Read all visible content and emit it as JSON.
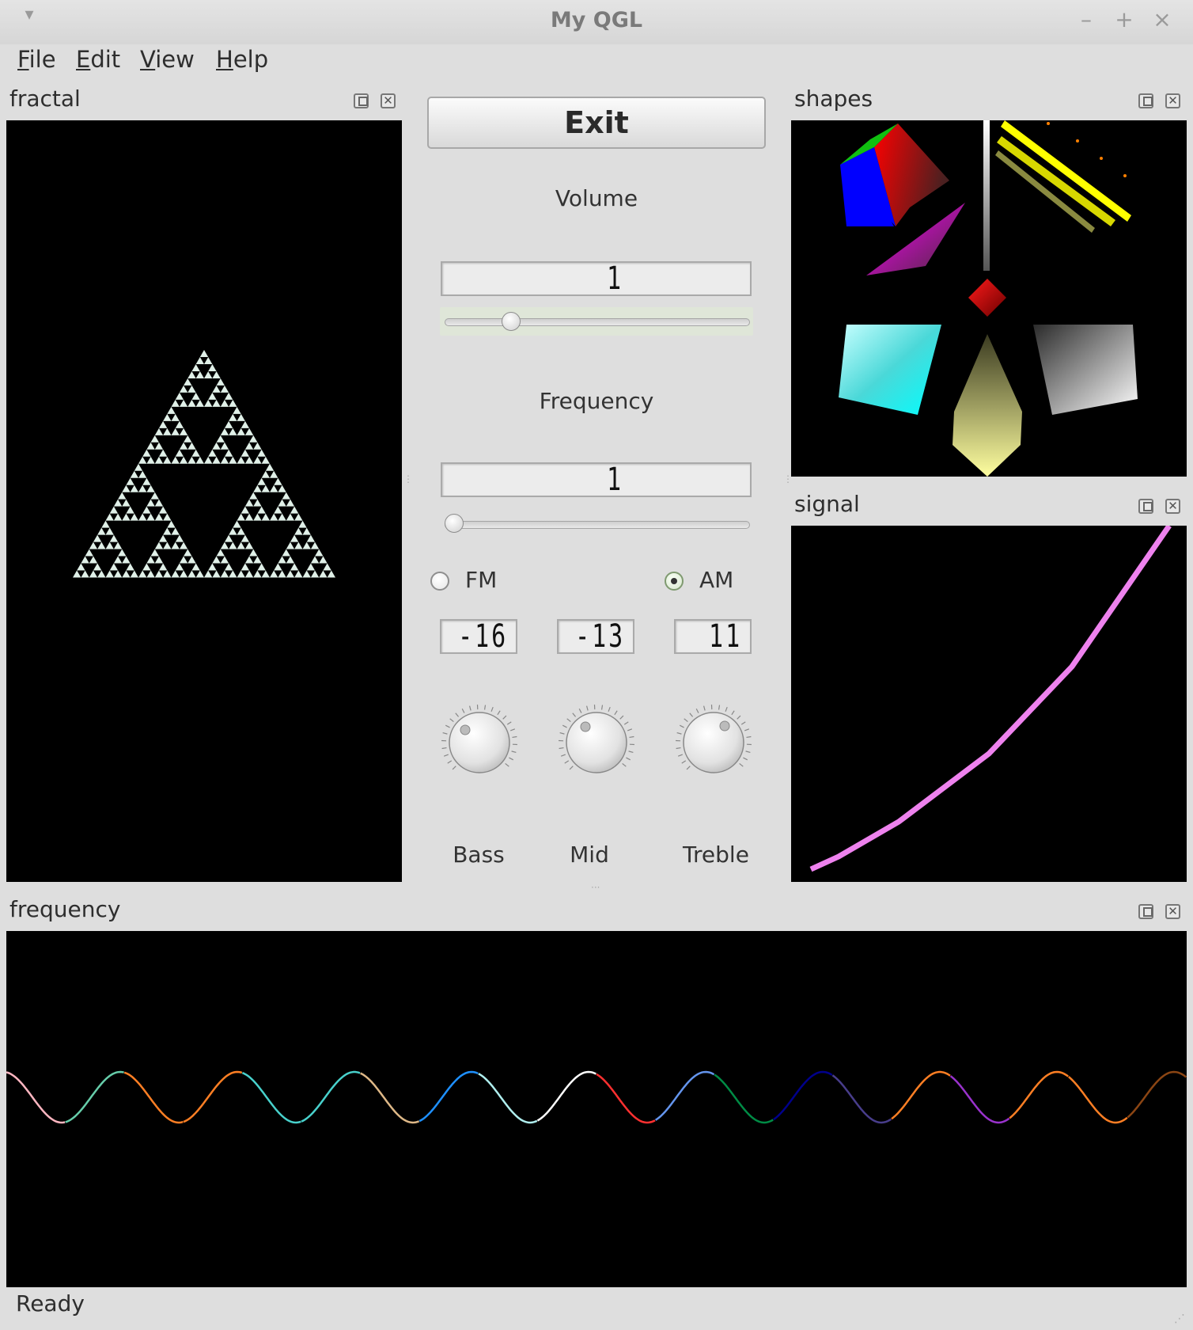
{
  "window": {
    "title": "My QGL"
  },
  "titlebar_buttons": {
    "minimize": "–",
    "maximize": "+",
    "close": "×",
    "menu": "▾"
  },
  "menubar": [
    {
      "mnemonic": "F",
      "rest": "ile"
    },
    {
      "mnemonic": "E",
      "rest": "dit"
    },
    {
      "mnemonic": "V",
      "rest": "iew"
    },
    {
      "mnemonic": "H",
      "rest": "elp"
    }
  ],
  "docks": {
    "fractal": "fractal",
    "shapes": "shapes",
    "signal": "signal",
    "frequency": "frequency"
  },
  "controls": {
    "exit_label": "Exit",
    "volume_label": "Volume",
    "volume_lcd": "1",
    "volume_slider": 0.2,
    "frequency_label": "Frequency",
    "frequency_lcd": "1",
    "frequency_slider": 0.0,
    "fm_label": "FM",
    "am_label": "AM",
    "selected_mode": "AM",
    "lcd_bass": "-16",
    "lcd_mid": "-13",
    "lcd_treble": "11",
    "bass_label": "Bass",
    "mid_label": "Mid",
    "treble_label": "Treble"
  },
  "status": {
    "text": "Ready"
  },
  "colors": {
    "signal_line": "#ee82ee",
    "fractal": "#e0f0e8",
    "wave_segments": [
      "#ffb6c1",
      "#66cdaa",
      "#ff7f24",
      "#ff7f24",
      "#48d1cc",
      "#48d1cc",
      "#deb887",
      "#1e90ff",
      "#afeeee",
      "#ffffff",
      "#ff3030",
      "#6495ed",
      "#008b45",
      "#00008b",
      "#483d8b",
      "#ff7f24",
      "#9932cc",
      "#ff7f24",
      "#ff7f24",
      "#8b4513"
    ]
  }
}
